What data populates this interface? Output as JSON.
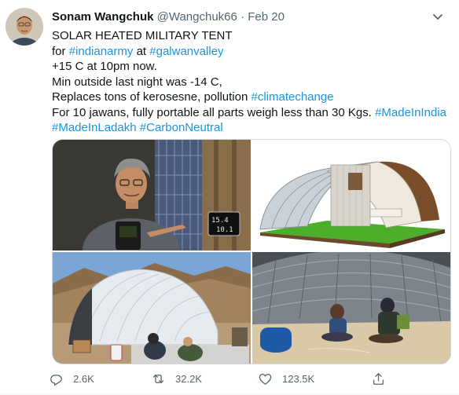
{
  "author": {
    "name": "Sonam Wangchuk",
    "handle": "@Wangchuk66",
    "separator": "·",
    "date": "Feb 20"
  },
  "tweet": {
    "line1": "SOLAR HEATED MILITARY TENT",
    "line2_prefix": "for ",
    "tag_indianarmy": "#indianarmy",
    "line2_mid": " at ",
    "tag_galwanvalley": "#galwanvalley",
    "line3": "+15 C at 10pm now.",
    "line4": "Min outside last night was -14 C,",
    "line5_prefix": "Replaces tons of kerosesne, pollution ",
    "tag_climatechange": "#climatechange",
    "line6_prefix": "For 10 jawans, fully portable all parts weigh less than 30 Kgs. ",
    "tag_madeinindia": "#MadeInIndia",
    "tag_madeinladakh": "#MadeInLadakh",
    "line7_space": " ",
    "tag_carbonneutral": "#CarbonNeutral"
  },
  "photo1": {
    "display_top": "15.4",
    "display_bottom": "10.1"
  },
  "stats": {
    "replies": "2.6K",
    "retweets": "32.2K",
    "likes": "123.5K"
  },
  "icons": {
    "reply": "reply-icon",
    "retweet": "retweet-icon",
    "like": "heart-icon",
    "share": "share-icon",
    "more": "chevron-down-icon"
  },
  "colors": {
    "link": "#1b95e0",
    "text": "#0f1419",
    "muted": "#536471"
  }
}
